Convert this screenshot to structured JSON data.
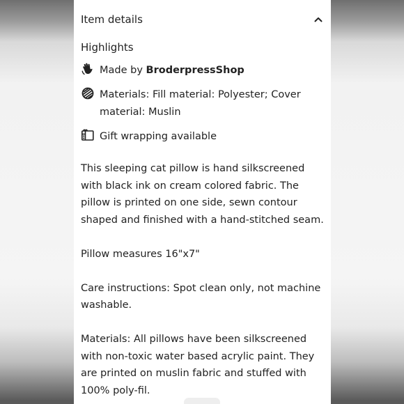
{
  "section": {
    "title": "Item details",
    "collapse_icon": "chevron-up-icon"
  },
  "highlights": {
    "title": "Highlights",
    "items": [
      {
        "icon": "hand-wave-icon",
        "prefix": "Made by ",
        "strong": "BroderpressShop"
      },
      {
        "icon": "materials-icon",
        "text": "Materials: Fill material: Polyester; Cover material: Muslin"
      },
      {
        "icon": "gift-icon",
        "text": "Gift wrapping available"
      }
    ]
  },
  "description": [
    "This sleeping cat pillow is hand silkscreened with black ink on cream colored fabric. The pillow is printed on one side, sewn contour shaped and finished with a hand-stitched seam.",
    "Pillow measures 16\"x7\"",
    "Care instructions: Spot clean only, not machine washable.",
    "Materials: All pillows have been silkscreened with non-toxic water based acrylic paint. They are printed on muslin fabric and stuffed with 100% poly-fil."
  ]
}
